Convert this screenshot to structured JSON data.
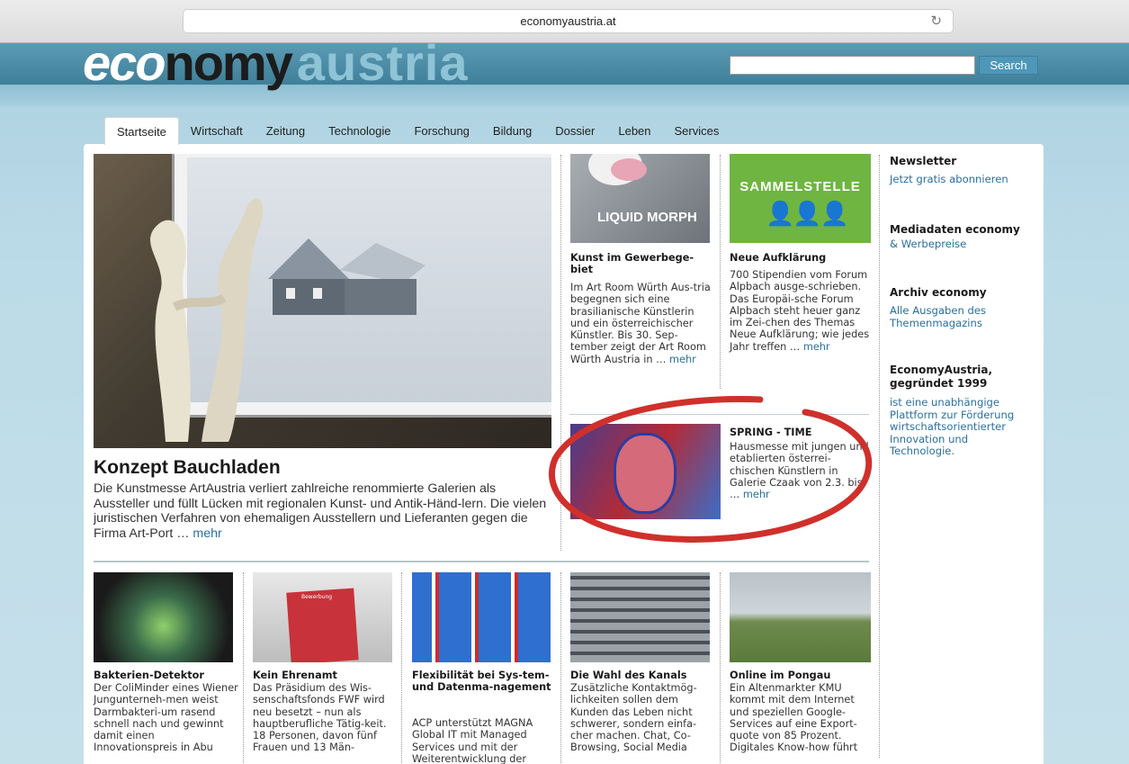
{
  "browser": {
    "url": "economyaustria.at",
    "reload_icon": "reload-icon"
  },
  "logo": {
    "part1": "eco",
    "part2": "nomy",
    "part3": "austria"
  },
  "search": {
    "button_label": "Search",
    "placeholder": ""
  },
  "tabs": [
    {
      "label": "Startseite",
      "active": true
    },
    {
      "label": "Wirtschaft"
    },
    {
      "label": "Zeitung"
    },
    {
      "label": "Technologie"
    },
    {
      "label": "Forschung"
    },
    {
      "label": "Bildung"
    },
    {
      "label": "Dossier"
    },
    {
      "label": "Leben"
    },
    {
      "label": "Services"
    }
  ],
  "hero": {
    "title": "Konzept Bauchladen",
    "text": "Die Kunstmesse ArtAustria verliert zahlreiche renommierte Galerien als Aussteller und füllt Lücken mit regionalen Kunst- und Antik-Händ-lern. Die vielen juristischen Verfahren von ehemaligen Ausstellern und Lieferanten gegen die Firma Art-Port …",
    "more": "mehr"
  },
  "articles_top": [
    {
      "title": "Kunst im Gewerbege-biet",
      "text": "Im Art Room Würth Aus-tria begegnen sich eine brasilianische Künstlerin und ein österreichischer Künstler. Bis 30. Sep-tember zeigt der Art Room Würth Austria in …",
      "more": "mehr",
      "image_text": "LIQUID MORPH"
    },
    {
      "title": "Neue Aufklärung",
      "text": "700 Stipendien vom Forum Alpbach ausge-schrieben. Das Europäi-sche Forum Alpbach steht heuer ganz im Zei-chen des Themas Neue Aufklärung; wie jedes Jahr treffen …",
      "more": "mehr",
      "image_text": "SAMMELSTELLE"
    },
    {
      "title": "SPRING - TIME",
      "text": "Hausmesse mit jungen und etablierten österrei-chischen Künstlern in Galerie Czaak von 2.3. bis …",
      "more": "mehr"
    }
  ],
  "articles_bottom": [
    {
      "title": "Bakterien-Detektor",
      "text": "Der ColiMinder eines Wiener Jungunterneh-men weist Darmbakteri-um rasend schnell nach und gewinnt damit einen Innovationspreis in Abu"
    },
    {
      "title": "Kein Ehrenamt",
      "text": "Das Präsidium des Wis-senschaftsfonds FWF wird neu besetzt – nun als hauptberufliche Tätig-keit. 18 Personen, davon fünf Frauen und 13 Män-"
    },
    {
      "title": "Flexibilität bei Sys-tem- und Datenma-nagement",
      "text": "ACP unterstützt MAGNA Global IT mit Managed Services und mit der Weiterentwicklung der"
    },
    {
      "title": "Die Wahl des Kanals",
      "text": "Zusätzliche Kontaktmög-lichkeiten sollen dem Kunden das Leben nicht schwerer, sondern einfa-cher machen. Chat, Co-Browsing, Social Media"
    },
    {
      "title": "Online im Pongau",
      "text": "Ein Altenmarkter KMU kommt mit dem Internet und speziellen Google-Services auf eine Export-quote von 85 Prozent. Digitales Know-how führt"
    }
  ],
  "bewerbung_label": "Bewerbung",
  "sidebar": {
    "newsletter_title": "Newsletter",
    "newsletter_link": "Jetzt gratis abonnieren",
    "media_title": "Mediadaten economy",
    "media_link": "& Werbepreise",
    "archive_title": "Archiv economy",
    "archive_link": "Alle Ausgaben des Themenmagazins",
    "about_title": "EconomyAustria, gegründet 1999",
    "about_text": "ist eine unabhängige Plattform zur Förderung wirtschaftsorientierter Innovation und Technologie."
  },
  "colors": {
    "header": "#4a8aa4",
    "link": "#2a6fa0",
    "annotation": "#d0302c"
  }
}
